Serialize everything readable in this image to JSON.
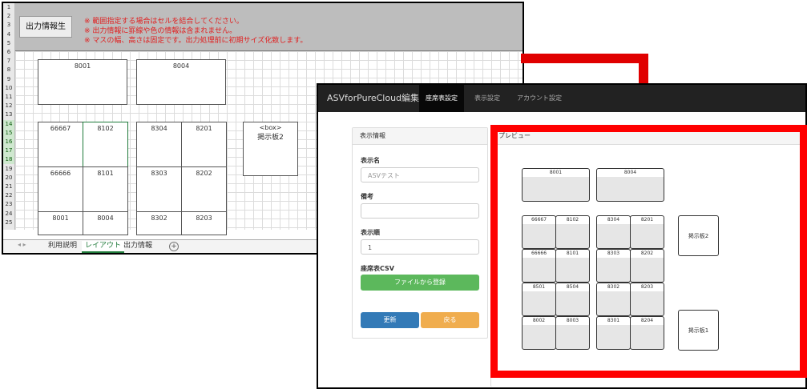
{
  "excel": {
    "generate_button": "出力情報生",
    "notes": [
      "※ 範囲指定する場合はセルを結合してください。",
      "※ 出力情報に罫線や色の情報は含まれません。",
      "※ マスの幅、高さは固定です。出力処理前に初期サイズ化致します。"
    ],
    "row_numbers": [
      "1",
      "2",
      "3",
      "4",
      "5",
      "6",
      "7",
      "8",
      "9",
      "10",
      "11",
      "12",
      "13",
      "14",
      "15",
      "16",
      "17",
      "18",
      "19",
      "20",
      "21",
      "22",
      "23",
      "24",
      "25"
    ],
    "cells": {
      "c8001a": "8001",
      "c8004a": "8004",
      "c66667": "66667",
      "c8102": "8102",
      "c8304": "8304",
      "c8201": "8201",
      "box": "<box>",
      "board2": "掲示板2",
      "c66666": "66666",
      "c8101": "8101",
      "c8303": "8303",
      "c8202": "8202",
      "c8001b": "8001",
      "c8004b": "8004",
      "c8302": "8302",
      "c8203": "8203"
    },
    "sheet_nav": "◂  ▸",
    "sheet_tabs": [
      "利用説明",
      "レイアウト",
      "出力情報"
    ],
    "add_sheet": "+"
  },
  "app": {
    "brand": "ASVforPureCloud編集",
    "nav": [
      "座席表設定",
      "表示設定",
      "アカウント設定"
    ],
    "form": {
      "panel_title": "表示情報",
      "display_name_label": "表示名",
      "display_name_value": "ASVテスト",
      "note_label": "備考",
      "note_value": "",
      "order_label": "表示順",
      "order_value": "1",
      "csv_label": "座席表CSV",
      "upload_button": "ファイルから登録",
      "update_button": "更新",
      "back_button": "戻る"
    },
    "preview": {
      "title": "プレビュー",
      "top": [
        "8001",
        "8004"
      ],
      "grid_left": [
        [
          "66667",
          "8102"
        ],
        [
          "66666",
          "8101"
        ],
        [
          "8501",
          "8504"
        ],
        [
          "8002",
          "8003"
        ]
      ],
      "grid_right": [
        [
          "8304",
          "8201"
        ],
        [
          "8303",
          "8202"
        ],
        [
          "8302",
          "8203"
        ],
        [
          "8301",
          "8204"
        ]
      ],
      "board2": "掲示板2",
      "board1": "掲示板1"
    }
  },
  "colors": {
    "accent_red": "#ff0000",
    "upload_green": "#5cb85c",
    "update_blue": "#337ab7",
    "back_orange": "#f0ad4e",
    "navbar": "#222222"
  }
}
